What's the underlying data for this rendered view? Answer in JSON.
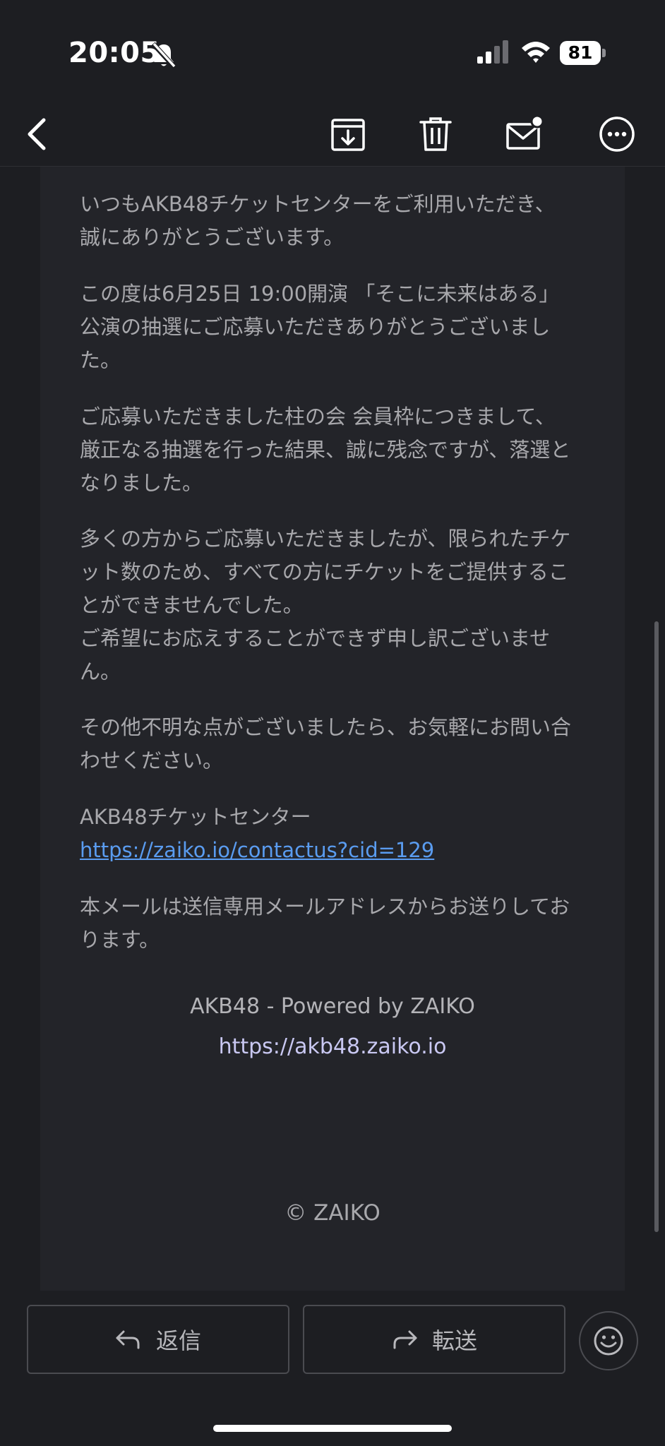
{
  "status_bar": {
    "time": "20:05",
    "battery": "81",
    "icons": [
      "bell-slash-icon",
      "signal-icon",
      "wifi-icon",
      "battery-icon"
    ]
  },
  "toolbar": {
    "icons": [
      "back-chevron-icon",
      "archive-icon",
      "trash-icon",
      "mail-unread-icon",
      "more-icon"
    ]
  },
  "email": {
    "p1": "いつもAKB48チケットセンターをご利用いただき、誠にありがとうございます。",
    "p2": "この度は6月25日 19:00開演 「そこに未来はある」公演の抽選にご応募いただきありがとうございました。",
    "p3": "ご応募いただきました柱の会 会員枠につきまして、厳正なる抽選を行った結果、誠に残念ですが、落選となりました。",
    "p4a": "多くの方からご応募いただきましたが、限られたチケット数のため、すべての方にチケットをご提供することができませんでした。",
    "p4b": "ご希望にお応えすることができず申し訳ございません。",
    "p5": "その他不明な点がございましたら、お気軽にお問い合わせください。",
    "sig_name": "AKB48チケットセンター",
    "sig_link": "https://zaiko.io/contactus?cid=129",
    "p6": "本メールは送信専用メールアドレスからお送りしております。",
    "footer_powered": "AKB48 - Powered by ZAIKO",
    "footer_url": "https://akb48.zaiko.io",
    "copyright": "© ZAIKO"
  },
  "actions": {
    "reply": "返信",
    "forward": "転送",
    "icons": [
      "reply-arrow-icon",
      "forward-arrow-icon",
      "emoji-icon"
    ]
  },
  "colors": {
    "background": "#1d1e22",
    "content_background": "#232429",
    "link": "#5a9cf0"
  }
}
